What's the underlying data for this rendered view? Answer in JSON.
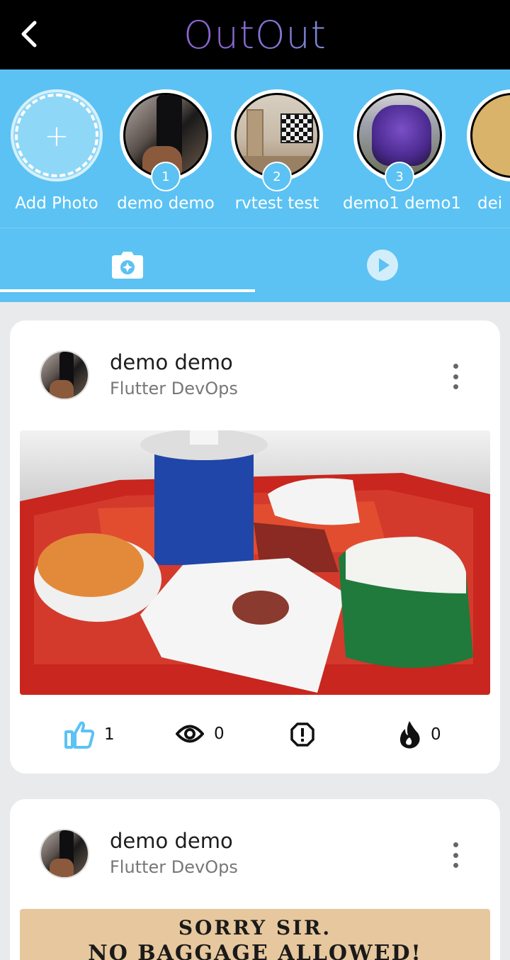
{
  "app": {
    "title": "OutOut"
  },
  "stories": {
    "add_label": "Add Photo",
    "items": [
      {
        "name": "demo demo",
        "badge": "1"
      },
      {
        "name": "rvtest test",
        "badge": "2"
      },
      {
        "name": "demo1 demo1",
        "badge": "3"
      },
      {
        "name": "dei"
      }
    ]
  },
  "tabs": {
    "active": "photos",
    "items": [
      {
        "id": "photos",
        "icon": "camera-icon"
      },
      {
        "id": "videos",
        "icon": "play-icon"
      }
    ]
  },
  "posts": [
    {
      "user_name": "demo demo",
      "subtitle": "Flutter DevOps",
      "likes": "1",
      "views": "0",
      "fire": "0"
    },
    {
      "user_name": "demo demo",
      "subtitle": "Flutter DevOps",
      "sign_line1": "SORRY SIR.",
      "sign_line2": "NO BAGGAGE ALLOWED!"
    }
  ],
  "colors": {
    "appbar": "#000000",
    "accent": "#5bc2f3",
    "like": "#5bc2f3"
  }
}
